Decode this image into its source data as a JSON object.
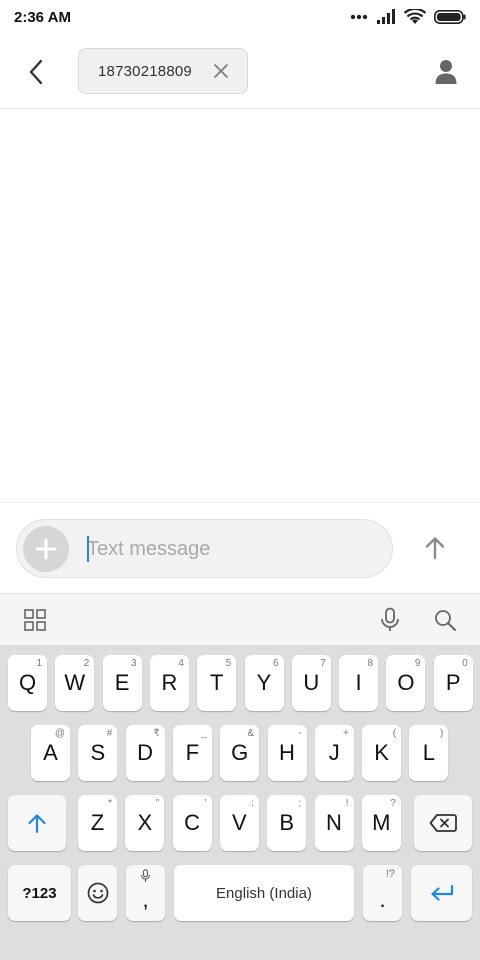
{
  "status_bar": {
    "time": "2:36 AM"
  },
  "header": {
    "recipient": "18730218809"
  },
  "compose": {
    "placeholder": "Text message"
  },
  "keyboard": {
    "row1": [
      {
        "key": "Q",
        "sub": "1"
      },
      {
        "key": "W",
        "sub": "2"
      },
      {
        "key": "E",
        "sub": "3"
      },
      {
        "key": "R",
        "sub": "4"
      },
      {
        "key": "T",
        "sub": "5"
      },
      {
        "key": "Y",
        "sub": "6"
      },
      {
        "key": "U",
        "sub": "7"
      },
      {
        "key": "I",
        "sub": "8"
      },
      {
        "key": "O",
        "sub": "9"
      },
      {
        "key": "P",
        "sub": "0"
      }
    ],
    "row2": [
      {
        "key": "A",
        "sub": "@"
      },
      {
        "key": "S",
        "sub": "#"
      },
      {
        "key": "D",
        "sub": "₹"
      },
      {
        "key": "F",
        "sub": "_"
      },
      {
        "key": "G",
        "sub": "&"
      },
      {
        "key": "H",
        "sub": "-"
      },
      {
        "key": "J",
        "sub": "+"
      },
      {
        "key": "K",
        "sub": "("
      },
      {
        "key": "L",
        "sub": ")"
      }
    ],
    "row3": [
      {
        "key": "Z",
        "sub": "*"
      },
      {
        "key": "X",
        "sub": "\""
      },
      {
        "key": "C",
        "sub": "'"
      },
      {
        "key": "V",
        "sub": ":"
      },
      {
        "key": "B",
        "sub": ";"
      },
      {
        "key": "N",
        "sub": "!"
      },
      {
        "key": "M",
        "sub": "?"
      }
    ],
    "symbols_label": "?123",
    "comma": ",",
    "period": ".",
    "period_sub": "!?",
    "space_label": "English (India)"
  },
  "colors": {
    "accent": "#1e88e5",
    "keyboard_bg": "#dedede"
  }
}
